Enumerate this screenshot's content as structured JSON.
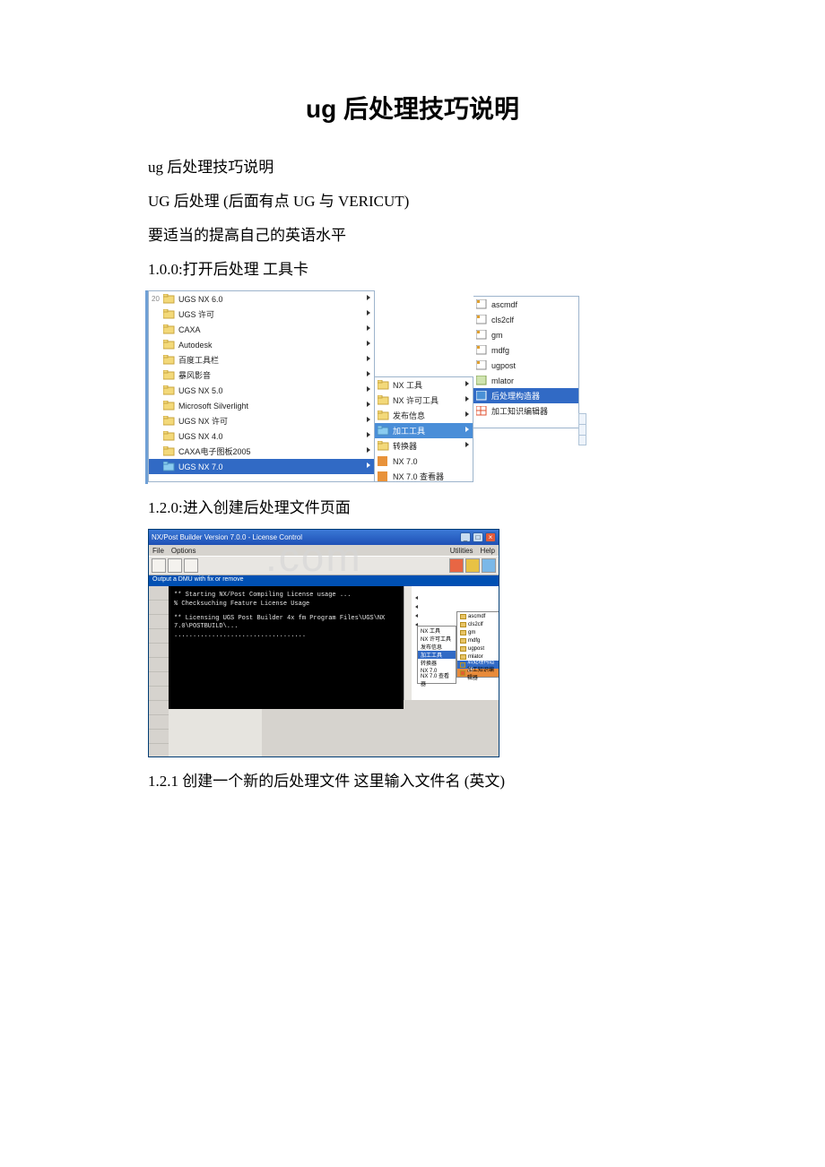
{
  "title": "ug 后处理技巧说明",
  "p1": "ug 后处理技巧说明",
  "p2": "UG 后处理 (后面有点 UG 与 VERICUT)",
  "p3": "要适当的提高自己的英语水平",
  "p4": "1.0.0:打开后处理 工具卡",
  "p5": "1.2.0:进入创建后处理文件页面",
  "p6": "1.2.1 创建一个新的后处理文件 这里输入文件名 (英文)",
  "menu1": {
    "col1_num": "20",
    "items1": [
      "UGS NX 6.0",
      "UGS 许可",
      "CAXA",
      "Autodesk",
      "百度工具栏",
      "暴风影音",
      "UGS NX 5.0",
      "Microsoft Silverlight",
      "UGS NX 许可",
      "UGS NX 4.0",
      "CAXA电子图板2005",
      "UGS NX 7.0"
    ],
    "items2": [
      "NX 工具",
      "NX 许可工具",
      "发布信息",
      "加工工具",
      "转换器",
      "NX 7.0",
      "NX 7.0 查看器"
    ],
    "items3": [
      "ascmdf",
      "cls2clf",
      "gm",
      "mdfg",
      "ugpost",
      "mlator",
      "后处理构造器",
      "加工知识编辑器"
    ]
  },
  "shot2": {
    "title": "NX/Post Builder Version 7.0.0 - License Control",
    "menubar_l": [
      "File",
      "Options"
    ],
    "menubar_r": [
      "Utilities",
      "Help"
    ],
    "bluebar": "Output a DMU with fix or remove",
    "black_l1": "** Starting NX/Post Compiling License usage ...",
    "black_l2": "% Checksuching Feature License Usage",
    "black_l3": "** Licensing UGS Post Builder 4x fm Program Files\\UGS\\NX 7.0\\POSTBUILD\\...",
    "black_l4": "...................................",
    "sub1": [
      "NX 工具",
      "NX 许可工具",
      "发布信息",
      "加工工具",
      "转换器",
      "NX 7.0",
      "NX 7.0 查看器"
    ],
    "sub2": [
      "ascmdf",
      "cls2clf",
      "gm",
      "mdfg",
      "ugpost",
      "mlator",
      "后处理构造器",
      "加工知识编辑器"
    ],
    "watermark": ".com"
  }
}
